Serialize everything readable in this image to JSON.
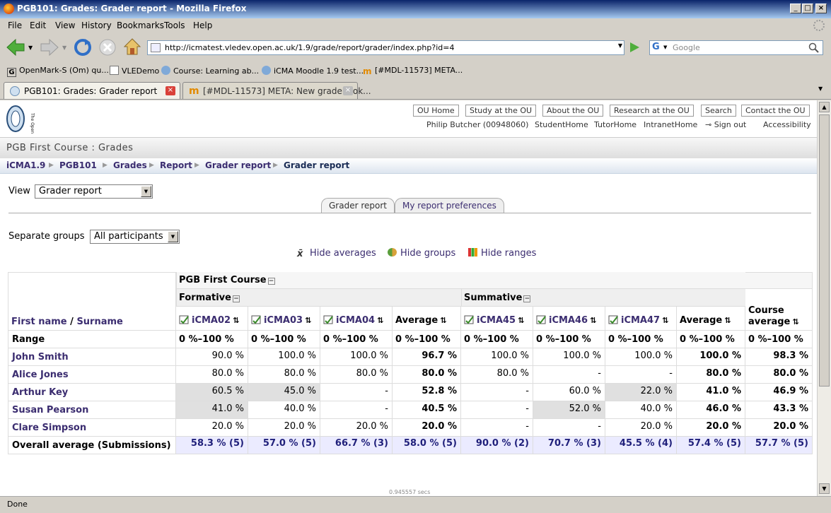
{
  "window": {
    "title": "PGB101: Grades: Grader report - Mozilla Firefox"
  },
  "menu": [
    "File",
    "Edit",
    "View",
    "History",
    "Bookmarks",
    "Tools",
    "Help"
  ],
  "nav": {
    "url": "http://icmatest.vledev.open.ac.uk/1.9/grade/report/grader/index.php?id=4",
    "search_placeholder": "Google"
  },
  "bookmarks": [
    {
      "label": "OpenMark-S (Om) qu...",
      "icon": "g-icon"
    },
    {
      "label": "VLEDemo",
      "icon": "page-icon"
    },
    {
      "label": "Course: Learning ab...",
      "icon": "globe-icon"
    },
    {
      "label": "iCMA Moodle 1.9 test...",
      "icon": "globe-icon"
    },
    {
      "label": "[#MDL-11573] META...",
      "icon": "moodle-icon"
    }
  ],
  "tabs": [
    {
      "label": "PGB101: Grades: Grader report",
      "active": true
    },
    {
      "label": "[#MDL-11573] META: New gradebook...",
      "active": false
    }
  ],
  "header": {
    "buttons": [
      "OU Home",
      "Study at the OU",
      "About the OU",
      "Research at the OU",
      "Search",
      "Contact the OU"
    ],
    "user": "Philip Butcher (00948060)",
    "links": [
      "StudentHome",
      "TutorHome",
      "IntranetHome",
      "Sign out",
      "Accessibility"
    ]
  },
  "course_title": "PGB First Course : Grades",
  "breadcrumb": [
    "iCMA1.9",
    "PGB101",
    "Grades",
    "Report",
    "Grader report",
    "Grader report"
  ],
  "view": {
    "label": "View",
    "value": "Grader report"
  },
  "report_tabs": [
    "Grader report",
    "My report preferences"
  ],
  "groups": {
    "label": "Separate groups",
    "value": "All participants"
  },
  "toggles": [
    "Hide averages",
    "Hide groups",
    "Hide ranges"
  ],
  "grades": {
    "course_header": "PGB First Course",
    "categories": [
      "Formative",
      "Summative"
    ],
    "name_header": {
      "first": "First name",
      "sep": " / ",
      "last": "Surname"
    },
    "columns": [
      "iCMA02",
      "iCMA03",
      "iCMA04",
      "Average",
      "iCMA45",
      "iCMA46",
      "iCMA47",
      "Average"
    ],
    "course_average_lines": [
      "Course",
      "average"
    ],
    "range_label": "Range",
    "range": [
      "0 %–100 %",
      "0 %–100 %",
      "0 %–100 %",
      "0 %–100 %",
      "0 %–100 %",
      "0 %–100 %",
      "0 %–100 %",
      "0 %–100 %",
      "0 %–100 %"
    ],
    "rows": [
      {
        "name": "John Smith",
        "values": [
          "90.0 %",
          "100.0 %",
          "100.0 %",
          "96.7 %",
          "100.0 %",
          "100.0 %",
          "100.0 %",
          "100.0 %",
          "98.3 %"
        ],
        "highlight": [
          false,
          false,
          false,
          false,
          false,
          false,
          false,
          false,
          false
        ]
      },
      {
        "name": "Alice Jones",
        "values": [
          "80.0 %",
          "80.0 %",
          "80.0 %",
          "80.0 %",
          "80.0 %",
          "-",
          "-",
          "80.0 %",
          "80.0 %"
        ],
        "highlight": [
          false,
          false,
          false,
          false,
          false,
          false,
          false,
          false,
          false
        ]
      },
      {
        "name": "Arthur Key",
        "values": [
          "60.5 %",
          "45.0 %",
          "-",
          "52.8 %",
          "-",
          "60.0 %",
          "22.0 %",
          "41.0 %",
          "46.9 %"
        ],
        "highlight": [
          true,
          true,
          false,
          false,
          false,
          false,
          true,
          false,
          false
        ]
      },
      {
        "name": "Susan Pearson",
        "values": [
          "41.0 %",
          "40.0 %",
          "-",
          "40.5 %",
          "-",
          "52.0 %",
          "40.0 %",
          "46.0 %",
          "43.3 %"
        ],
        "highlight": [
          true,
          false,
          false,
          false,
          false,
          true,
          false,
          false,
          false
        ]
      },
      {
        "name": "Clare Simpson",
        "values": [
          "20.0 %",
          "20.0 %",
          "20.0 %",
          "20.0 %",
          "-",
          "-",
          "20.0 %",
          "20.0 %",
          "20.0 %"
        ],
        "highlight": [
          false,
          false,
          false,
          false,
          false,
          false,
          false,
          false,
          false
        ]
      }
    ],
    "overall_label": "Overall average (Submissions)",
    "overall": [
      "58.3 % (5)",
      "57.0 % (5)",
      "66.7 % (3)",
      "58.0 % (5)",
      "90.0 % (2)",
      "70.7 % (3)",
      "45.5 % (4)",
      "57.4 % (5)",
      "57.7 % (5)"
    ]
  },
  "timing": "0.945557 secs",
  "status": "Done",
  "colors": {
    "link": "#3b2d70",
    "avg_row_bg": "#ebebff",
    "highlight_bg": "#e0e0e0"
  }
}
